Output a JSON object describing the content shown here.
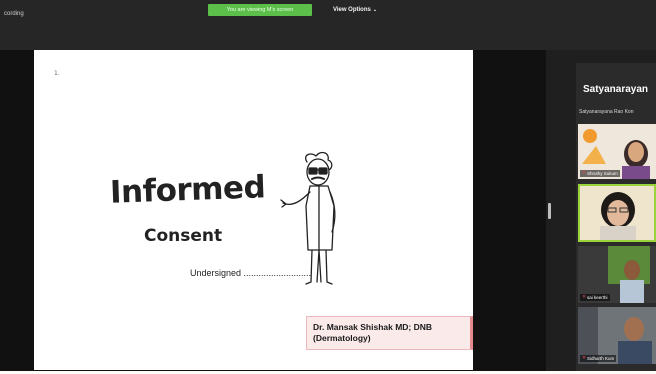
{
  "topbar": {
    "recording_label": "cording",
    "viewing_banner": "You are viewing M's screen",
    "view_options_label": "View Options",
    "view_options_icon": "chevron-down-icon"
  },
  "slide": {
    "corner_mark": "1.",
    "title_main": "Informed",
    "title_sub": "Consent",
    "signature_text": "Undersigned ...........................",
    "credit_line1": "Dr. Mansak Shishak MD; DNB",
    "credit_line2": "(Dermatology)",
    "illustration": "cartoon-doctor-pointing"
  },
  "participants_panel": {
    "title": "Satyanarayan",
    "subtitle": "Satyanarayana Rao Kon",
    "tiles": [
      {
        "name": "Shruthy Sukum",
        "muted": true
      },
      {
        "name": "",
        "muted": false,
        "active": true
      },
      {
        "name": "sai keerthi",
        "muted": true
      },
      {
        "name": "Sidharth Kum",
        "muted": true
      }
    ]
  },
  "colors": {
    "banner_green": "#5cbf4a",
    "active_tile_border": "#9bd43a",
    "credit_bg": "#fbeaea",
    "credit_accent": "#e58a8f",
    "muted_mic": "#e34a4a"
  }
}
